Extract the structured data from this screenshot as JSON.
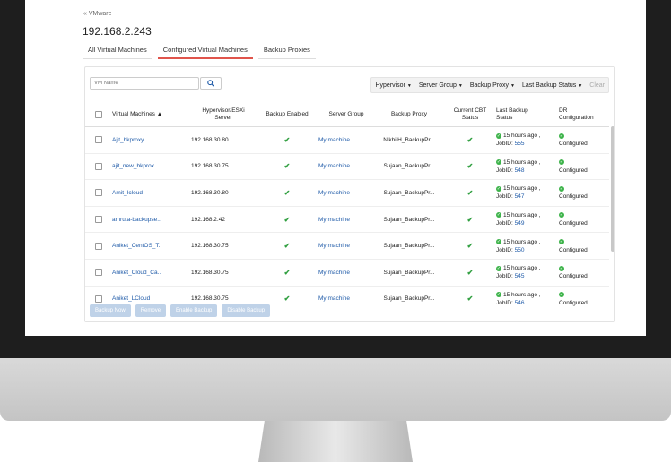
{
  "breadcrumb": "« VMware",
  "host_title": "192.168.2.243",
  "tabs": [
    {
      "label": "All Virtual Machines"
    },
    {
      "label": "Configured Virtual Machines"
    },
    {
      "label": "Backup Proxies"
    }
  ],
  "search": {
    "placeholder": "VM Name"
  },
  "filters": {
    "hypervisor": "Hypervisor",
    "server_group": "Server Group",
    "backup_proxy": "Backup Proxy",
    "last_backup_status": "Last Backup Status",
    "clear": "Clear"
  },
  "columns": {
    "vm": "Virtual Machines",
    "sort_indicator": "▲",
    "hypervisor_line1": "Hypervisor/ESXi",
    "hypervisor_line2": "Server",
    "backup_enabled": "Backup Enabled",
    "server_group": "Server Group",
    "backup_proxy": "Backup Proxy",
    "cbt_line1": "Current CBT",
    "cbt_line2": "Status",
    "last_backup_line1": "Last Backup",
    "last_backup_line2": "Status",
    "dr_line1": "DR",
    "dr_line2": "Configuration"
  },
  "rows": [
    {
      "vm": "Ajit_bkproxy",
      "server": "192.168.30.80",
      "group": "My machine",
      "proxy": "NikhilH_BackupPr...",
      "when": "15 hours ago ,",
      "jobid_label": "JobID:",
      "jobid": "555",
      "dr": "Configured"
    },
    {
      "vm": "ajit_new_bkprox..",
      "server": "192.168.30.75",
      "group": "My machine",
      "proxy": "Sujaan_BackupPr...",
      "when": "15 hours ago ,",
      "jobid_label": "JobID:",
      "jobid": "548",
      "dr": "Configured"
    },
    {
      "vm": "Amit_Icloud",
      "server": "192.168.30.80",
      "group": "My machine",
      "proxy": "Sujaan_BackupPr...",
      "when": "15 hours ago ,",
      "jobid_label": "JobID:",
      "jobid": "547",
      "dr": "Configured"
    },
    {
      "vm": "amruta-backupse..",
      "server": "192.168.2.42",
      "group": "My machine",
      "proxy": "Sujaan_BackupPr...",
      "when": "15 hours ago ,",
      "jobid_label": "JobID:",
      "jobid": "549",
      "dr": "Configured"
    },
    {
      "vm": "Aniket_CentOS_T..",
      "server": "192.168.30.75",
      "group": "My machine",
      "proxy": "Sujaan_BackupPr...",
      "when": "15 hours ago ,",
      "jobid_label": "JobID:",
      "jobid": "550",
      "dr": "Configured"
    },
    {
      "vm": "Aniket_Cloud_Ca..",
      "server": "192.168.30.75",
      "group": "My machine",
      "proxy": "Sujaan_BackupPr...",
      "when": "15 hours ago ,",
      "jobid_label": "JobID:",
      "jobid": "545",
      "dr": "Configured"
    },
    {
      "vm": "Aniket_LCloud",
      "server": "192.168.30.75",
      "group": "My machine",
      "proxy": "Sujaan_BackupPr...",
      "when": "15 hours ago ,",
      "jobid_label": "JobID:",
      "jobid": "546",
      "dr": "Configured"
    }
  ],
  "buttons": {
    "backup_now": "Backup Now",
    "remove": "Remove",
    "enable_backup": "Enable Backup",
    "disable_backup": "Disable Backup"
  },
  "colors": {
    "accent_tab": "#e0544b",
    "link": "#1e5aa8",
    "ok": "#2e9e3e"
  },
  "icons": {
    "search": "search-icon",
    "status_ok": "check-icon"
  }
}
